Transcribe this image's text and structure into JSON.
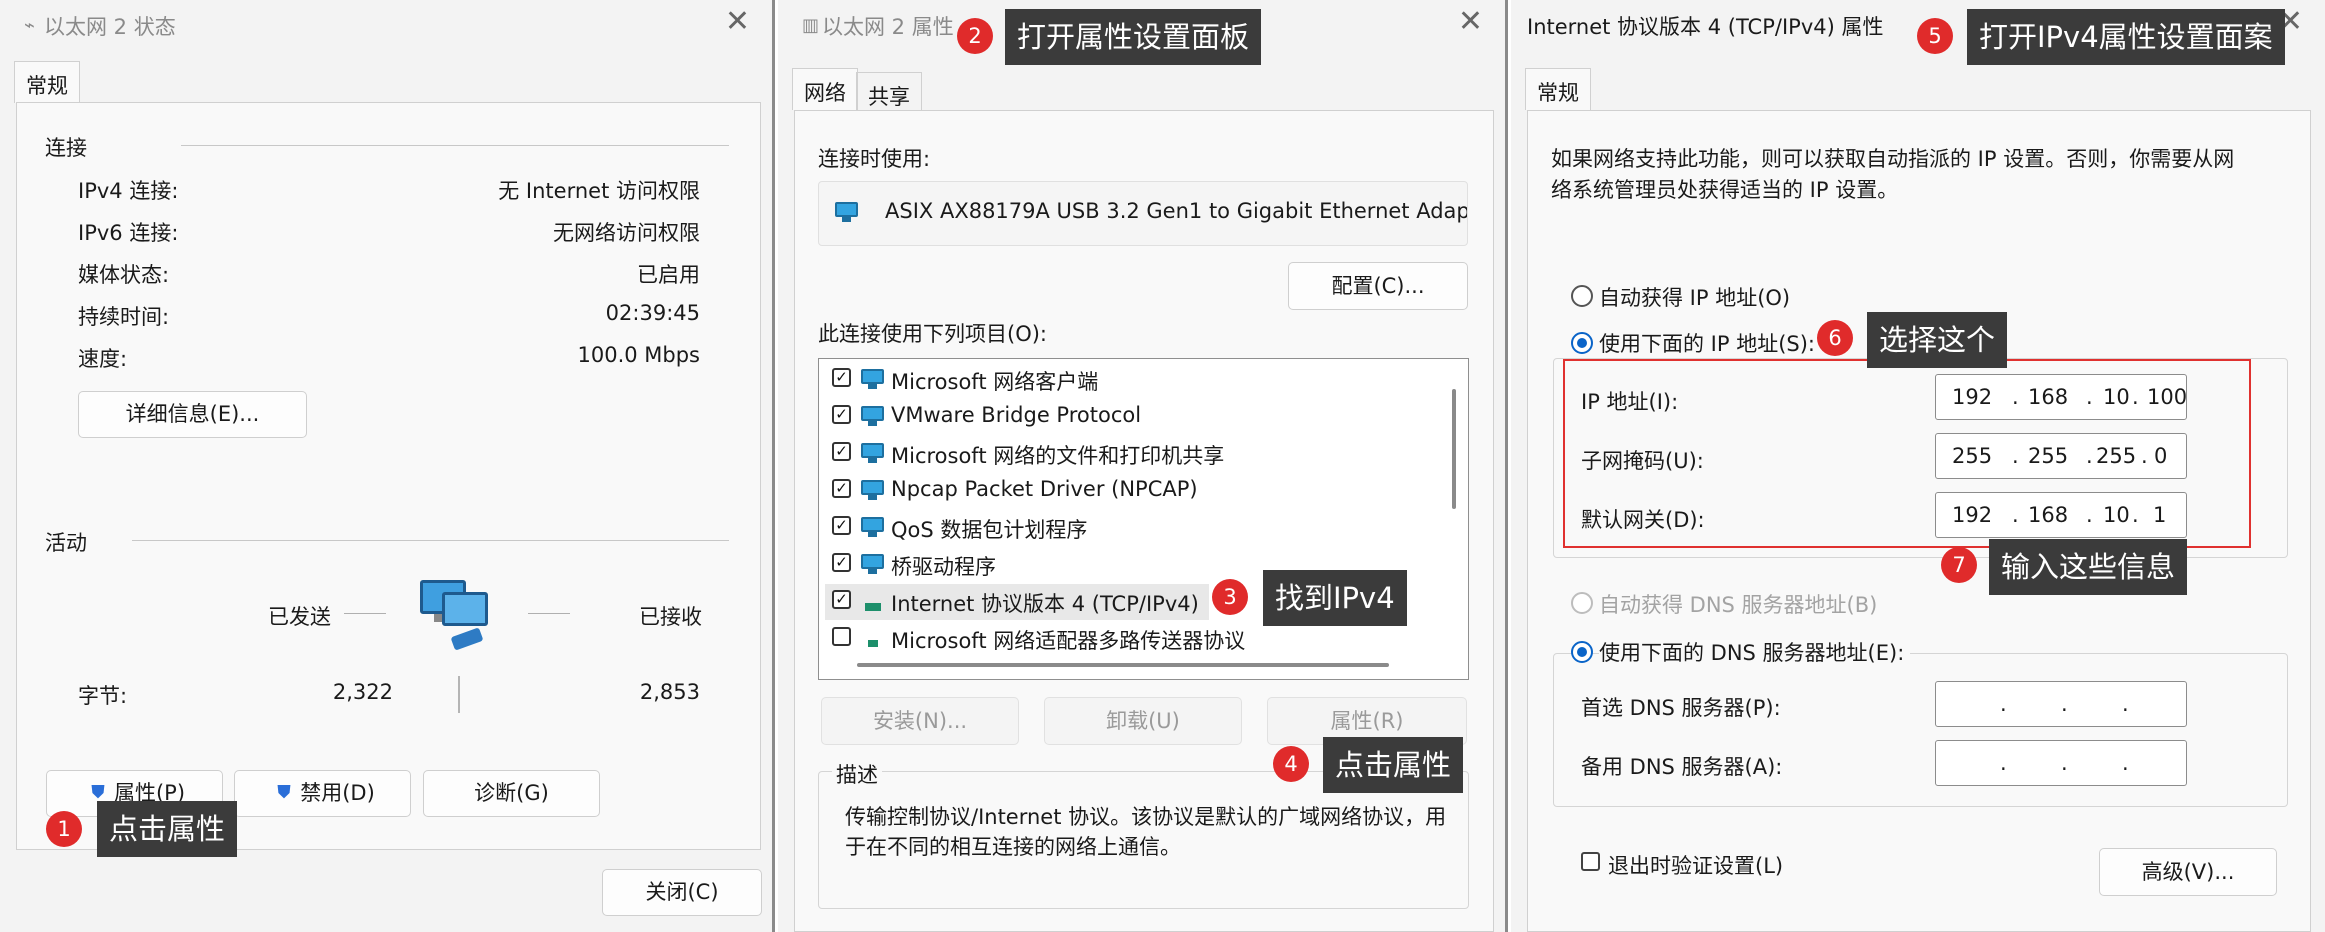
{
  "w1": {
    "title": "以太网 2 状态",
    "tab": "常规",
    "sec_connection": "连接",
    "rows": [
      {
        "label": "IPv4 连接:",
        "value": "无 Internet 访问权限"
      },
      {
        "label": "IPv6 连接:",
        "value": "无网络访问权限"
      },
      {
        "label": "媒体状态:",
        "value": "已启用"
      },
      {
        "label": "持续时间:",
        "value": "02:39:45"
      },
      {
        "label": "速度:",
        "value": "100.0 Mbps"
      }
    ],
    "details_btn": "详细信息(E)...",
    "sec_activity": "活动",
    "sent": "已发送",
    "received": "已接收",
    "bytes_label": "字节:",
    "bytes_sent": "2,322",
    "bytes_received": "2,853",
    "btn_properties": "属性(P)",
    "btn_disable": "禁用(D)",
    "btn_diagnose": "诊断(G)",
    "btn_close": "关闭(C)"
  },
  "w2": {
    "title": "以太网 2 属性",
    "tabs": [
      "网络",
      "共享"
    ],
    "connect_using": "连接时使用:",
    "adapter": "ASIX AX88179A USB 3.2 Gen1 to Gigabit Ethernet Adap",
    "config_btn": "配置(C)...",
    "items_label": "此连接使用下列项目(O):",
    "items": [
      {
        "label": "Microsoft 网络客户端",
        "checked": true
      },
      {
        "label": "VMware Bridge Protocol",
        "checked": true
      },
      {
        "label": "Microsoft 网络的文件和打印机共享",
        "checked": true
      },
      {
        "label": "Npcap Packet Driver (NPCAP)",
        "checked": true
      },
      {
        "label": "QoS 数据包计划程序",
        "checked": true
      },
      {
        "label": "桥驱动程序",
        "checked": true
      },
      {
        "label": "Internet 协议版本 4 (TCP/IPv4)",
        "checked": true
      },
      {
        "label": "Microsoft 网络适配器多路传送器协议",
        "checked": false
      }
    ],
    "btn_install": "安装(N)...",
    "btn_uninstall": "卸载(U)",
    "btn_properties": "属性(R)",
    "desc_label": "描述",
    "desc_line1": "传输控制协议/Internet 协议。该协议是默认的广域网络协议，用",
    "desc_line2": "于在不同的相互连接的网络上通信。"
  },
  "w3": {
    "title": "Internet 协议版本 4 (TCP/IPv4) 属性",
    "tab": "常规",
    "info_line1": "如果网络支持此功能，则可以获取自动指派的 IP 设置。否则，你需要从网",
    "info_line2": "络系统管理员处获得适当的 IP 设置。",
    "auto_ip": "自动获得 IP 地址(O)",
    "use_ip": "使用下面的 IP 地址(S):",
    "ip_label": "IP 地址(I):",
    "ip": [
      "192",
      "168",
      "10",
      "100"
    ],
    "mask_label": "子网掩码(U):",
    "mask": [
      "255",
      "255",
      "255",
      "0"
    ],
    "gw_label": "默认网关(D):",
    "gw": [
      "192",
      "168",
      "10",
      "1"
    ],
    "auto_dns": "自动获得 DNS 服务器地址(B)",
    "use_dns": "使用下面的 DNS 服务器地址(E):",
    "pref_dns": "首选 DNS 服务器(P):",
    "alt_dns": "备用 DNS 服务器(A):",
    "dot": ".",
    "validate": "退出时验证设置(L)",
    "advanced_btn": "高级(V)..."
  },
  "annotations": [
    {
      "num": "1",
      "text": "点击属性"
    },
    {
      "num": "2",
      "text": "打开属性设置面板"
    },
    {
      "num": "3",
      "text": "找到IPv4"
    },
    {
      "num": "4",
      "text": "点击属性"
    },
    {
      "num": "5",
      "text": "打开IPv4属性设置面案"
    },
    {
      "num": "6",
      "text": "选择这个"
    },
    {
      "num": "7",
      "text": "输入这些信息"
    }
  ],
  "colors": {
    "annotation_badge": "#e02b2b",
    "annotation_label": "#3b3b3b",
    "highlight_box": "#e0312f",
    "radio_selected": "#0a64c8"
  }
}
